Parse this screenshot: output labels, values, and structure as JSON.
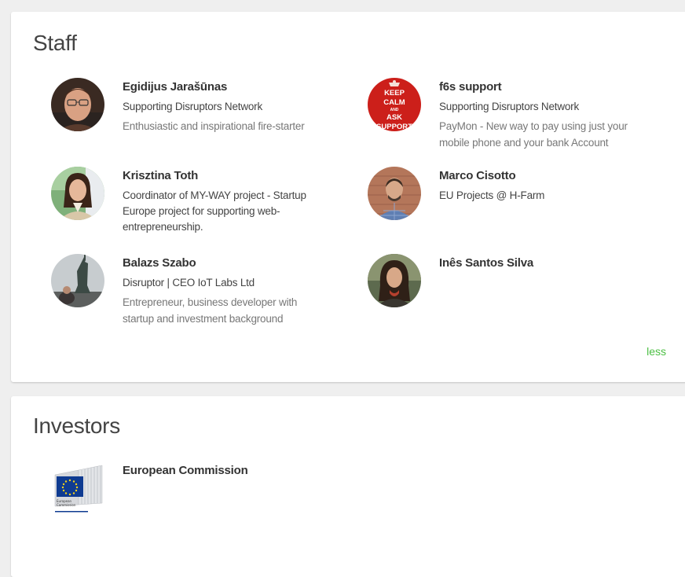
{
  "staff": {
    "title": "Staff",
    "less_label": "less",
    "people": [
      {
        "name": "Egidijus Jarašūnas",
        "role": "Supporting Disruptors Network",
        "bio": "Enthusiastic and inspirational fire-starter"
      },
      {
        "name": "f6s support",
        "role": "Supporting Disruptors Network",
        "bio": "PayMon - New way to pay using just your mobile phone and your bank Account",
        "avatar_text": [
          "KEEP",
          "CALM",
          "AND",
          "ASK",
          "SUPPORT"
        ]
      },
      {
        "name": "Krisztina Toth",
        "role": "Coordinator of MY-WAY project - Startup Europe project for supporting web-entrepreneurship.",
        "bio": ""
      },
      {
        "name": "Marco Cisotto",
        "role": "EU Projects @ H-Farm",
        "bio": ""
      },
      {
        "name": "Balazs Szabo",
        "role": "Disruptor | CEO IoT Labs Ltd",
        "bio": "Entrepreneur, business developer with startup and investment background"
      },
      {
        "name": "Inês Santos Silva",
        "role": "",
        "bio": ""
      }
    ]
  },
  "investors": {
    "title": "Investors",
    "items": [
      {
        "name": "European Commission",
        "logo_caption": [
          "European",
          "Commission"
        ]
      }
    ]
  },
  "colors": {
    "link": "#4bbf43",
    "keep_calm_red": "#cc1f1a",
    "eu_blue": "#0f3b91",
    "eu_star": "#f5d21a"
  }
}
